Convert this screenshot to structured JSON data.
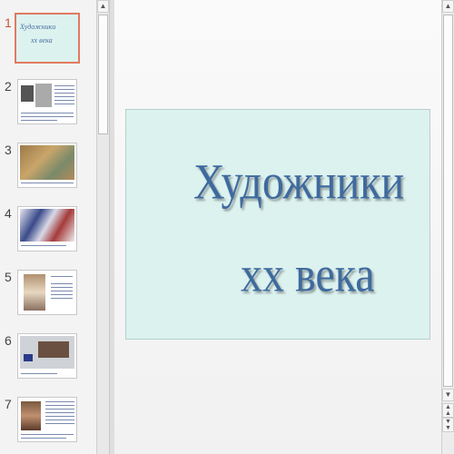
{
  "thumbnails": [
    {
      "number": "1",
      "selected": true,
      "mini_title1": "Художники",
      "mini_title2": "хх века"
    },
    {
      "number": "2",
      "selected": false
    },
    {
      "number": "3",
      "selected": false
    },
    {
      "number": "4",
      "selected": false
    },
    {
      "number": "5",
      "selected": false
    },
    {
      "number": "6",
      "selected": false
    },
    {
      "number": "7",
      "selected": false
    }
  ],
  "slide": {
    "title_line1": "Художники",
    "title_line2": "хх века",
    "background": "#dcf2ef",
    "text_color": "#3f6a9e"
  },
  "icons": {
    "scroll_up": "chevron-up-icon",
    "scroll_down": "chevron-down-icon",
    "prev_slide": "double-chevron-up-icon",
    "next_slide": "double-chevron-down-icon"
  }
}
